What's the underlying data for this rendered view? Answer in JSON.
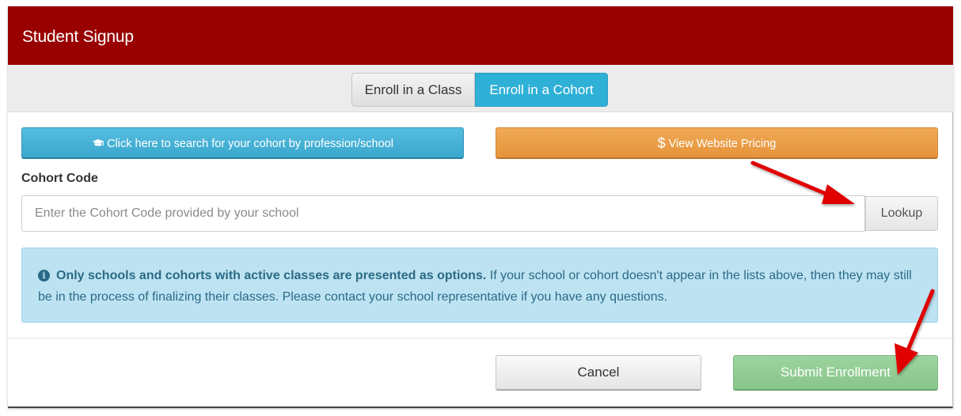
{
  "modal": {
    "title": "Student Signup"
  },
  "tabs": [
    {
      "label": "Enroll in a Class",
      "active": false
    },
    {
      "label": "Enroll in a Cohort",
      "active": true
    }
  ],
  "buttons": {
    "search_label": "Click here to search for your cohort by profession/school",
    "search_icon": "graduation-cap-icon",
    "pricing_label": "View Website Pricing",
    "pricing_icon": "dollar-icon",
    "lookup_label": "Lookup",
    "cancel_label": "Cancel",
    "submit_label": "Submit Enrollment"
  },
  "cohort_code": {
    "label": "Cohort Code",
    "placeholder": "Enter the Cohort Code provided by your school",
    "value": ""
  },
  "alert": {
    "icon": "info-icon",
    "strong": "Only schools and cohorts with active classes are presented as options.",
    "text": " If your school or cohort doesn't appear in the lists above, then they may still be in the process of finalizing their classes. Please contact your school representative if you have any questions."
  },
  "colors": {
    "header": "#990000",
    "tab_active": "#2fb0d6",
    "search_button": "#46b2d8",
    "pricing_button": "#eba048",
    "submit_button": "#8fcb91",
    "alert_bg": "#bde3f2",
    "annotation_arrow": "#e00000"
  },
  "annotations": {
    "arrow_icon": "red-arrow-icon"
  }
}
